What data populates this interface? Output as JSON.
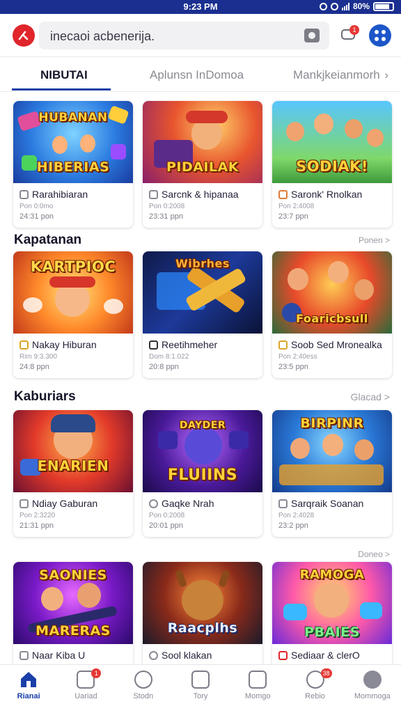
{
  "status_bar": {
    "time": "9:23 PM",
    "battery": "80%"
  },
  "header": {
    "search_text": "inecaoi acbenerija.",
    "chat_badge": "1"
  },
  "tabs": [
    {
      "label": "NIBUTAI",
      "active": true
    },
    {
      "label": "Aplunsn InDomoa",
      "active": false
    },
    {
      "label": "Mankjkeianmorh",
      "active": false
    }
  ],
  "sections": [
    {
      "title": "",
      "more": "",
      "cards": [
        {
          "name": "Rarahibiaran",
          "thumb_title": "HIBERIAS",
          "thumb_title_top": "HUBANAN",
          "meta": "Pon 0:0mo",
          "time": "24:31 pon"
        },
        {
          "name": "Sarcnk & hipanaa",
          "thumb_title": "PIDAILAK",
          "thumb_title_top": "",
          "meta": "Pon 0:2008",
          "time": "23:31 ppn"
        },
        {
          "name": "Saronk' Rnolkan",
          "thumb_title": "SODIAK!",
          "thumb_title_top": "",
          "meta": "Pon 2:4008",
          "time": "23:7 ppn"
        }
      ]
    },
    {
      "title": "Kapatanan",
      "more": "Ponen >",
      "cards": [
        {
          "name": "Nakay Hiburan",
          "thumb_title": "KARTPIOC",
          "thumb_title_top": "",
          "meta": "Rim 9:3.300",
          "time": "24:8 ppn"
        },
        {
          "name": "Reetihmeher",
          "thumb_title": "Wibrhes",
          "thumb_title_top": "",
          "meta": "Dom 8:1.022",
          "time": "20:8 ppn"
        },
        {
          "name": "Soob Sed Mronealka",
          "thumb_title": "Foaricbsull",
          "thumb_title_top": "",
          "meta": "Pon 2:40ess",
          "time": "23:5 ppn"
        }
      ]
    },
    {
      "title": "Kaburiars",
      "more": "Glacad >",
      "cards": [
        {
          "name": "Ndiay Gaburan",
          "thumb_title": "ENARIEN",
          "thumb_title_top": "",
          "meta": "Pon 2:3220",
          "time": "21:31 ppn"
        },
        {
          "name": "Gaqke Nrah",
          "thumb_title": "FLUIINS",
          "thumb_title_top": "DAYDER",
          "meta": "Pon 0:2008",
          "time": "20:01 ppn"
        },
        {
          "name": "Sarqraik Soanan",
          "thumb_title": "BIRPINR",
          "thumb_title_top": "",
          "meta": "Pon 2:4028",
          "time": "23:2 ppn"
        }
      ]
    },
    {
      "title": "",
      "more": "Doneo >",
      "cards": [
        {
          "name": "Naar Kiba U",
          "thumb_title": "MARERAS",
          "thumb_title_top": "SAONIES",
          "meta": "",
          "time": ""
        },
        {
          "name": "Sool klakan",
          "thumb_title": "Raacplhs",
          "thumb_title_top": "",
          "meta": "",
          "time": ""
        },
        {
          "name": "Sediaar & clerO",
          "thumb_title": "PBAIES",
          "thumb_title_top": "RAMOGA",
          "meta": "",
          "time": ""
        }
      ]
    }
  ],
  "bottom_nav": [
    {
      "label": "Rianai",
      "active": true,
      "badge": ""
    },
    {
      "label": "Uariad",
      "active": false,
      "badge": "1"
    },
    {
      "label": "Stodn",
      "active": false,
      "badge": ""
    },
    {
      "label": "Tory",
      "active": false,
      "badge": ""
    },
    {
      "label": "Momgo",
      "active": false,
      "badge": ""
    },
    {
      "label": "Rebio",
      "active": false,
      "badge": "38"
    },
    {
      "label": "Mommoga",
      "active": false,
      "badge": ""
    }
  ],
  "colors": {
    "status_bar": "#1a2f8f",
    "accent": "#1a3fa8",
    "logo": "#e0252b",
    "menu_button": "#1d56c8",
    "badge": "#e53935"
  }
}
